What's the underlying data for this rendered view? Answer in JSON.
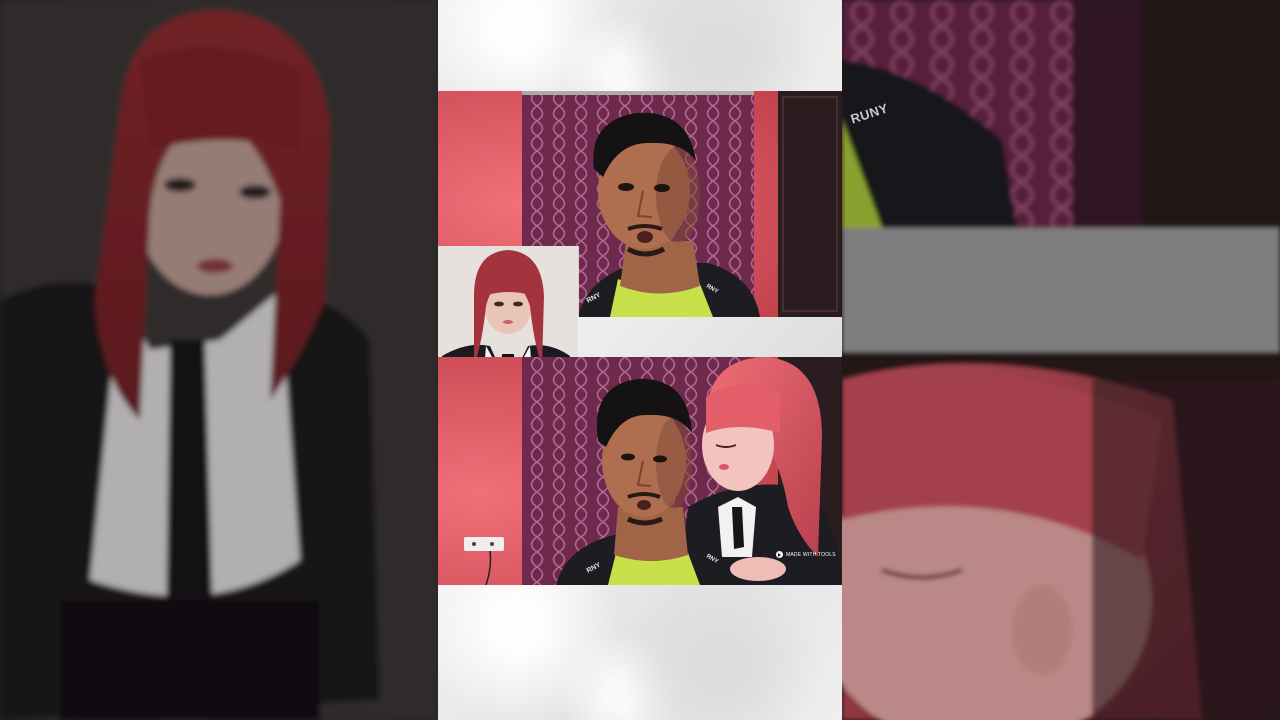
{
  "video": {
    "overlay_badge_text": "MADE WITH TOOLS",
    "shirt_brand_text": "RUNY",
    "shirt_brand_short": "RNY"
  },
  "colors": {
    "wall_pink": "#e85a63",
    "curtain_purple": "#7c2f56",
    "hair_red": "#d04a55",
    "paper_white": "#ececec"
  },
  "layout_regions": [
    "blurred-left-background",
    "center-video-column",
    "blurred-right-background"
  ]
}
